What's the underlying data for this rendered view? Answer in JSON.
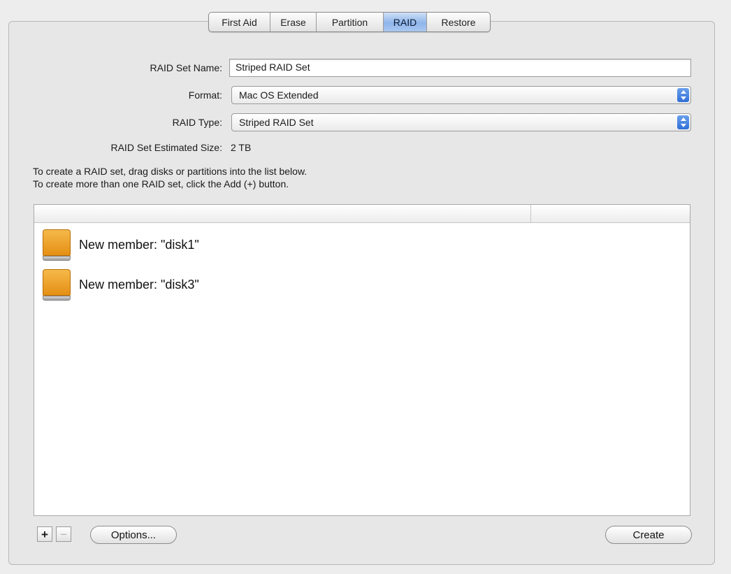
{
  "tabs": [
    "First Aid",
    "Erase",
    "Partition",
    "RAID",
    "Restore"
  ],
  "active_tab": "RAID",
  "form": {
    "name_label": "RAID Set Name:",
    "name_value": "Striped RAID Set",
    "format_label": "Format:",
    "format_value": "Mac OS Extended",
    "type_label": "RAID Type:",
    "type_value": "Striped RAID Set",
    "size_label": "RAID Set Estimated Size:",
    "size_value": "2 TB"
  },
  "instructions": {
    "line1": "To create a RAID set, drag disks or partitions into the list below.",
    "line2": "To create more than one RAID set, click the Add (+) button."
  },
  "members": [
    {
      "label": "New member: \"disk1\"",
      "icon": "external-disk-icon"
    },
    {
      "label": "New member: \"disk3\"",
      "icon": "external-disk-icon"
    }
  ],
  "footer": {
    "add_label": "+",
    "remove_label": "−",
    "options_label": "Options...",
    "create_label": "Create"
  },
  "colors": {
    "active_tab": "#8fb5ea",
    "disk_orange": "#e58f14",
    "popup_arrows": "#2e6fd8"
  }
}
